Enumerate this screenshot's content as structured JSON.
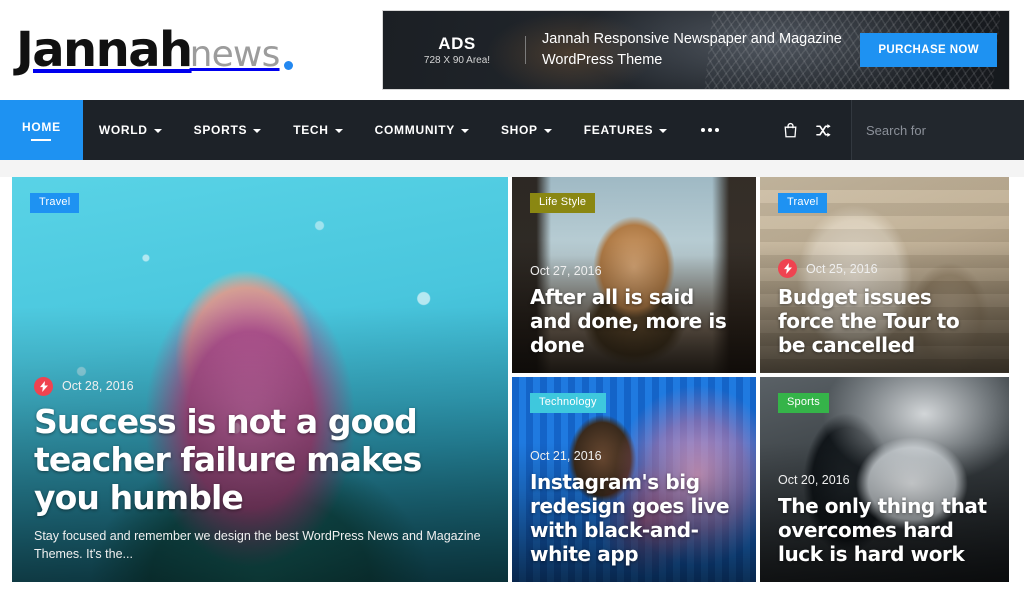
{
  "site": {
    "logo_main": "Jannah",
    "logo_sub": "news"
  },
  "ad": {
    "label": "ADS",
    "size_text": "728 X 90 Area!",
    "headline": "Jannah Responsive Newspaper and Magazine WordPress Theme",
    "cta_label": "PURCHASE NOW"
  },
  "nav": {
    "items": [
      {
        "label": "HOME",
        "has_caret": false,
        "active": true
      },
      {
        "label": "WORLD",
        "has_caret": true,
        "active": false
      },
      {
        "label": "SPORTS",
        "has_caret": true,
        "active": false
      },
      {
        "label": "TECH",
        "has_caret": true,
        "active": false
      },
      {
        "label": "COMMUNITY",
        "has_caret": true,
        "active": false
      },
      {
        "label": "SHOP",
        "has_caret": true,
        "active": false
      },
      {
        "label": "FEATURES",
        "has_caret": true,
        "active": false
      }
    ],
    "more_icon": "ellipsis-icon",
    "cart_icon": "shopping-bag-icon",
    "random_icon": "shuffle-icon",
    "search": {
      "placeholder": "Search for",
      "value": "",
      "icon": "search-icon"
    }
  },
  "colors": {
    "accent_blue": "#1e92f2",
    "nav_bg": "#1d2228",
    "trending_red": "#ef4350",
    "badge_travel": "#1e92f2",
    "badge_lifestyle": "#8a8712",
    "badge_technology": "#3ec8dd",
    "badge_sports": "#35b449"
  },
  "articles": [
    {
      "badge": "Travel",
      "badge_color": "#1e92f2",
      "trending": true,
      "date": "Oct 28, 2016",
      "title": "Success is not a good teacher failure makes you humble",
      "excerpt": "Stay focused and remember we design the best WordPress News and Magazine Themes. It's the..."
    },
    {
      "badge": "Life Style",
      "badge_color": "#8a8712",
      "trending": false,
      "date": "Oct 27, 2016",
      "title": "After all is said and done, more is done",
      "excerpt": ""
    },
    {
      "badge": "Travel",
      "badge_color": "#1e92f2",
      "trending": true,
      "date": "Oct 25, 2016",
      "title": "Budget issues force the Tour to be cancelled",
      "excerpt": ""
    },
    {
      "badge": "Technology",
      "badge_color": "#3ec8dd",
      "trending": false,
      "date": "Oct 21, 2016",
      "title": "Instagram's big redesign goes live with black-and-white app",
      "excerpt": ""
    },
    {
      "badge": "Sports",
      "badge_color": "#35b449",
      "trending": false,
      "date": "Oct 20, 2016",
      "title": "The only thing that overcomes hard luck is hard work",
      "excerpt": ""
    }
  ]
}
